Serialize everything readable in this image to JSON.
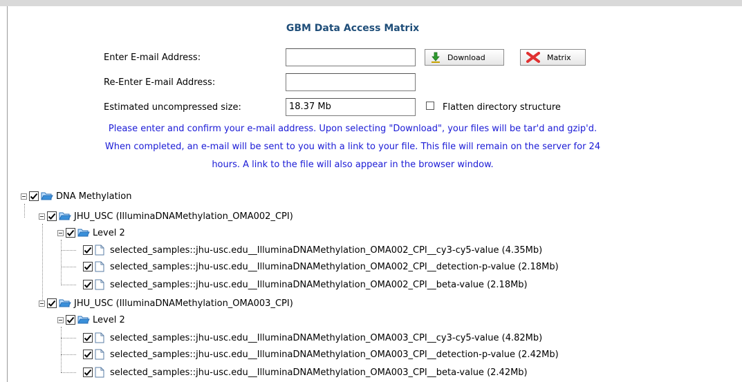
{
  "title": "GBM Data Access Matrix",
  "form": {
    "email_label": "Enter E-mail Address:",
    "email_value": "",
    "reemail_label": "Re-Enter E-mail Address:",
    "reemail_value": "",
    "size_label": "Estimated uncompressed size:",
    "size_value": "18.37 Mb",
    "flatten_label": "Flatten directory structure",
    "flatten_checked": false,
    "download_label": "Download",
    "matrix_label": "Matrix"
  },
  "note": {
    "line1": "Please enter and confirm your e-mail address. Upon selecting \"Download\", your files will be tar'd and gzip'd.",
    "line2": "When completed, an e-mail will be sent to you with a link to your file. This file will remain on the server for 24",
    "line3": "hours. A link to the file will also appear in the browser window."
  },
  "tree": {
    "root": {
      "label": "DNA Methylation",
      "checked": true
    },
    "centers": [
      {
        "label": "JHU_USC (IlluminaDNAMethylation_OMA002_CPI)",
        "checked": true,
        "level": {
          "label": "Level 2",
          "checked": true
        },
        "files": [
          {
            "label": "selected_samples::jhu-usc.edu__IlluminaDNAMethylation_OMA002_CPI__cy3-cy5-value (4.35Mb)",
            "checked": true
          },
          {
            "label": "selected_samples::jhu-usc.edu__IlluminaDNAMethylation_OMA002_CPI__detection-p-value (2.18Mb)",
            "checked": true
          },
          {
            "label": "selected_samples::jhu-usc.edu__IlluminaDNAMethylation_OMA002_CPI__beta-value (2.18Mb)",
            "checked": true
          }
        ]
      },
      {
        "label": "JHU_USC (IlluminaDNAMethylation_OMA003_CPI)",
        "checked": true,
        "level": {
          "label": "Level 2",
          "checked": true
        },
        "files": [
          {
            "label": "selected_samples::jhu-usc.edu__IlluminaDNAMethylation_OMA003_CPI__cy3-cy5-value (4.82Mb)",
            "checked": true
          },
          {
            "label": "selected_samples::jhu-usc.edu__IlluminaDNAMethylation_OMA003_CPI__detection-p-value (2.42Mb)",
            "checked": true
          },
          {
            "label": "selected_samples::jhu-usc.edu__IlluminaDNAMethylation_OMA003_CPI__beta-value (2.42Mb)",
            "checked": true
          }
        ]
      }
    ]
  },
  "colors": {
    "title": "#1f4e79",
    "note": "#1a1ad6",
    "folder": "#3a8fd9",
    "download_icon": "#2e9b2e",
    "matrix_icon": "#e03030"
  }
}
